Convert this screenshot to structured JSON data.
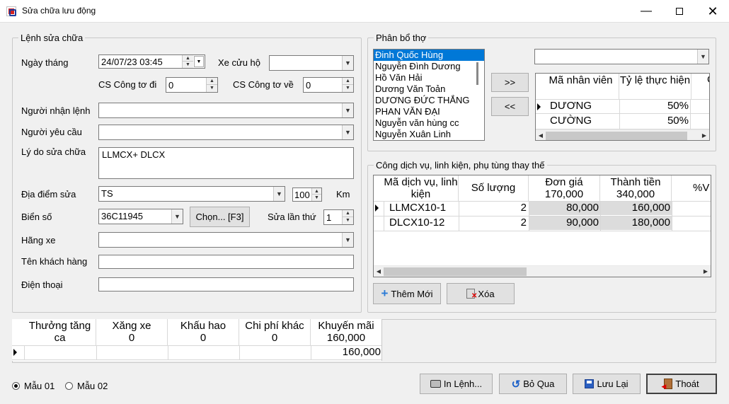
{
  "window": {
    "title": "Sửa chữa lưu động"
  },
  "lenh": {
    "legend": "Lệnh sửa chữa",
    "ngay_thang_label": "Ngày tháng",
    "ngay_thang_value": "24/07/23 03:45",
    "xe_cuu_ho_label": "Xe cửu hộ",
    "cs_cong_to_di_label": "CS Công tơ đi",
    "cs_cong_to_di_value": "0",
    "cs_cong_to_ve_label": "CS Công tơ về",
    "cs_cong_to_ve_value": "0",
    "nguoi_nhan_lenh_label": "Người nhận lệnh",
    "nguoi_yeu_cau_label": "Người yêu cầu",
    "ly_do_label": "Lý do sửa chữa",
    "ly_do_value": "LLMCX+ DLCX",
    "dia_diem_label": "Địa điểm sửa",
    "dia_diem_value": "TS",
    "km_value": "100",
    "km_label": "Km",
    "bien_so_label": "Biển số",
    "bien_so_value": "36C11945",
    "chon_button": "Chọn... [F3]",
    "sua_lan_thu_label": "Sửa lần thứ",
    "sua_lan_thu_value": "1",
    "hang_xe_label": "Hãng xe",
    "ten_khach_hang_label": "Tên khách hàng",
    "dien_thoai_label": "Điện thoại"
  },
  "phan_bo": {
    "legend": "Phân bổ thợ",
    "workers": [
      "Đinh Quốc Hùng",
      "Nguyễn Đình Dương",
      "Hồ Văn Hải",
      "Dương Văn Toản",
      "DƯƠNG ĐỨC THẮNG",
      "PHAN VĂN ĐẠI",
      "Nguyễn văn hùng cc",
      "Nguyễn Xuân Linh"
    ],
    "add_button": ">>",
    "remove_button": "<<",
    "columns": [
      "Mã nhân viên",
      "Tỷ lệ thực hiện",
      "C"
    ],
    "rows": [
      [
        "DƯƠNG",
        "50%"
      ],
      [
        "CƯỜNG",
        "50%"
      ]
    ]
  },
  "dich_vu": {
    "legend": "Công dịch vụ, linh kiện, phụ tùng thay thế",
    "columns": [
      "Mã dịch vụ, linh kiện",
      "Số lượng",
      "Đơn giá",
      "Thành tiền",
      "%V"
    ],
    "col_totals": [
      "",
      "",
      "170,000",
      "340,000",
      ""
    ],
    "rows": [
      [
        "LLMCX10-1",
        "2",
        "80,000",
        "160,000"
      ],
      [
        "DLCX10-12",
        "2",
        "90,000",
        "180,000"
      ]
    ],
    "them_moi_button": "Thêm Mới",
    "xoa_button": "Xóa"
  },
  "summary": {
    "columns": [
      "Thưởng tăng ca",
      "Xăng xe",
      "Khấu hao",
      "Chi phí khác",
      "Khuyến mãi"
    ],
    "col_totals": [
      "",
      "0",
      "0",
      "0",
      "160,000"
    ],
    "row": [
      "",
      "",
      "",
      "",
      "160,000"
    ]
  },
  "footer": {
    "mau01": "Mẫu 01",
    "mau02": "Mẫu 02",
    "in_lenh": "In Lệnh...",
    "bo_qua": "Bỏ Qua",
    "luu_lai": "Lưu Lại",
    "thoat": "Thoát"
  }
}
